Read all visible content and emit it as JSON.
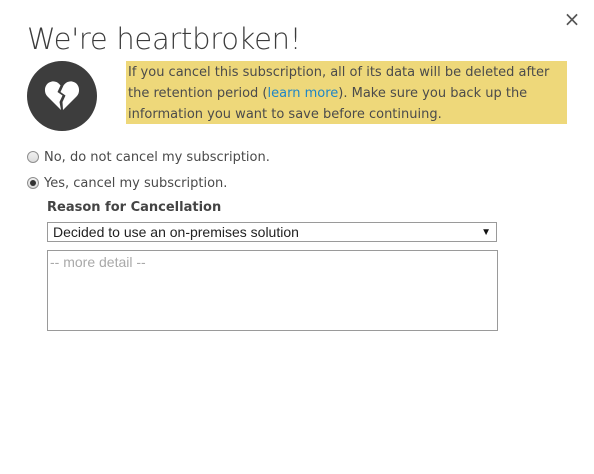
{
  "dialog": {
    "title": "We're heartbroken!",
    "close_glyph": "×"
  },
  "icon": {
    "name": "broken-heart-icon"
  },
  "warning": {
    "text_before": "If you cancel this subscription, all of its data will be deleted after the retention period (",
    "link": "learn more",
    "text_after": "). Make sure you back up the information you want to save before continuing.",
    "background": "#eed87a",
    "link_color": "#1f86c5"
  },
  "options": {
    "no_label": "No, do not cancel my subscription.",
    "yes_label": "Yes, cancel my subscription.",
    "selected": "yes"
  },
  "reason": {
    "label": "Reason for Cancellation",
    "selected_value": "Decided to use an on-premises solution",
    "detail_placeholder": "-- more detail --"
  }
}
